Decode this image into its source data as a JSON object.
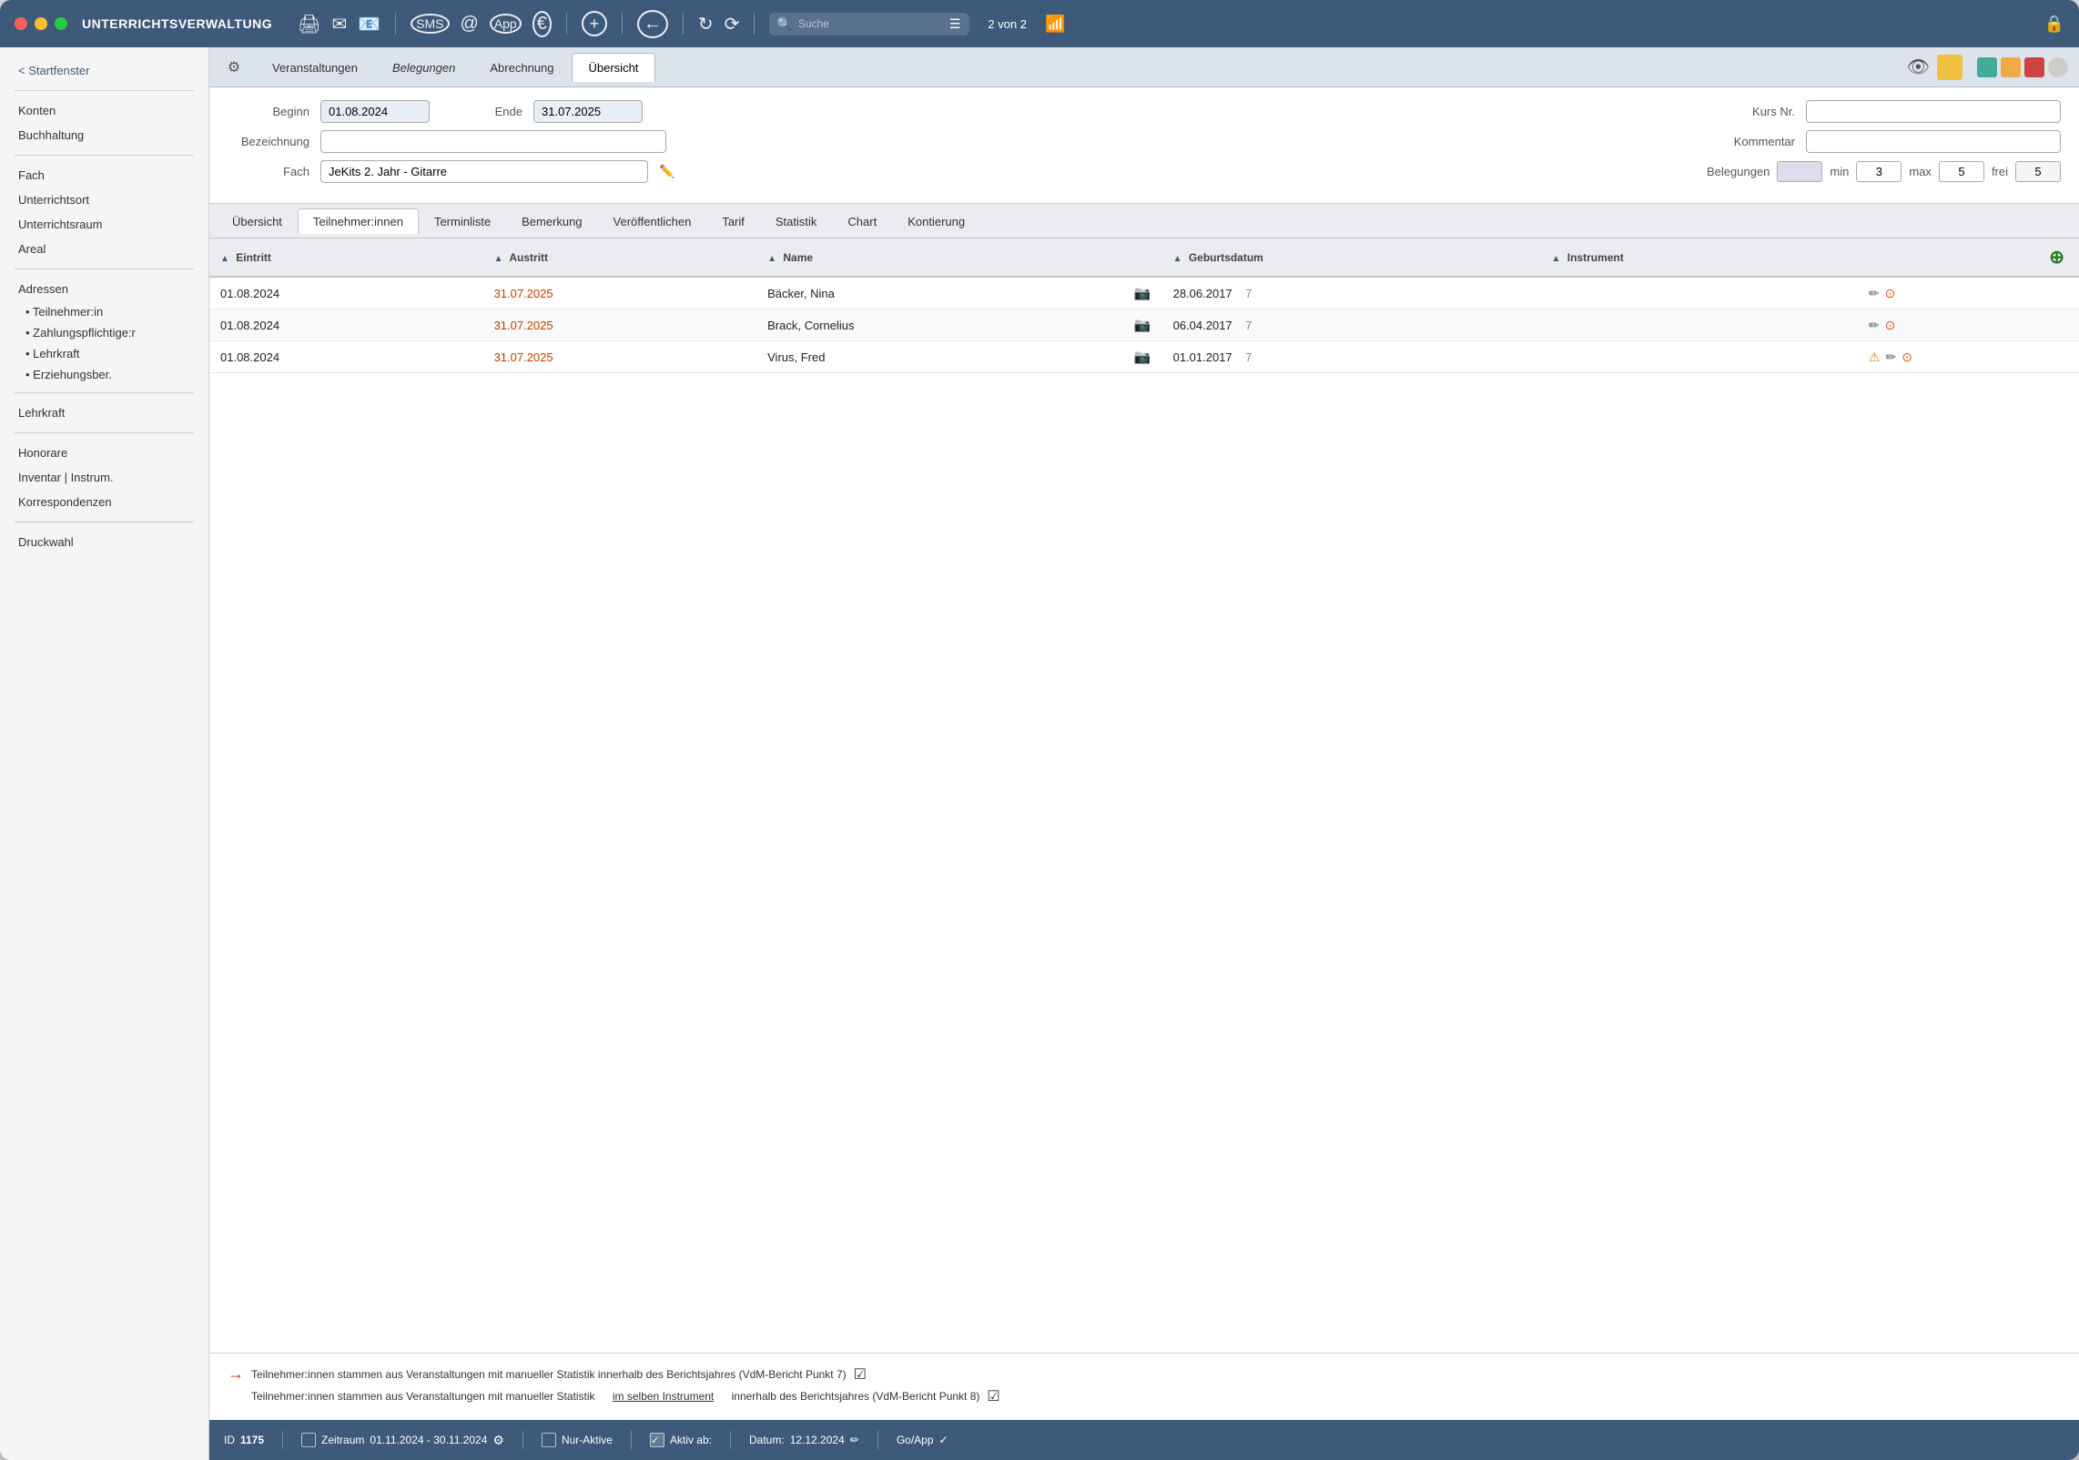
{
  "window": {
    "title": "UNTERRICHTSVERWALTUNG"
  },
  "titlebar": {
    "app_name": "UNTERRICHTSVERWALTUNG",
    "record_nav": "2 von 2",
    "search_placeholder": "Suche"
  },
  "main_tabs": {
    "items": [
      {
        "id": "veranstaltungen",
        "label": "Veranstaltungen",
        "active": false
      },
      {
        "id": "belegungen",
        "label": "Belegungen",
        "active": false
      },
      {
        "id": "abrechnung",
        "label": "Abrechnung",
        "active": false
      },
      {
        "id": "uebersicht",
        "label": "Übersicht",
        "active": true
      }
    ]
  },
  "form": {
    "beginn_label": "Beginn",
    "beginn_value": "01.08.2024",
    "ende_label": "Ende",
    "ende_value": "31.07.2025",
    "kurs_nr_label": "Kurs Nr.",
    "kurs_nr_value": "",
    "bezeichnung_label": "Bezeichnung",
    "bezeichnung_value": "",
    "kommentar_label": "Kommentar",
    "kommentar_value": "",
    "fach_label": "Fach",
    "fach_value": "JeKits 2. Jahr - Gitarre",
    "belegungen_label": "Belegungen",
    "belegungen_value": "",
    "min_label": "min",
    "min_value": "3",
    "max_label": "max",
    "max_value": "5",
    "frei_label": "frei",
    "frei_value": "5"
  },
  "sub_tabs": {
    "items": [
      {
        "id": "uebersicht",
        "label": "Übersicht",
        "active": false
      },
      {
        "id": "teilnehmer",
        "label": "Teilnehmer:innen",
        "active": true
      },
      {
        "id": "terminliste",
        "label": "Terminliste",
        "active": false
      },
      {
        "id": "bemerkung",
        "label": "Bemerkung",
        "active": false
      },
      {
        "id": "veroeffentlichen",
        "label": "Veröffentlichen",
        "active": false
      },
      {
        "id": "tarif",
        "label": "Tarif",
        "active": false
      },
      {
        "id": "statistik",
        "label": "Statistik",
        "active": false
      },
      {
        "id": "chart",
        "label": "Chart",
        "active": false
      },
      {
        "id": "kontierung",
        "label": "Kontierung",
        "active": false
      }
    ]
  },
  "table": {
    "columns": [
      {
        "id": "eintritt",
        "label": "Eintritt"
      },
      {
        "id": "austritt",
        "label": "Austritt"
      },
      {
        "id": "name",
        "label": "Name"
      },
      {
        "id": "foto",
        "label": ""
      },
      {
        "id": "geburtsdatum",
        "label": "Geburtsdatum"
      },
      {
        "id": "instrument",
        "label": "Instrument"
      }
    ],
    "rows": [
      {
        "eintritt": "01.08.2024",
        "austritt": "31.07.2025",
        "name": "Bäcker, Nina",
        "geburtsdatum": "28.06.2017",
        "age": "7",
        "instrument": "",
        "has_warning": false
      },
      {
        "eintritt": "01.08.2024",
        "austritt": "31.07.2025",
        "name": "Brack, Cornelius",
        "geburtsdatum": "06.04.2017",
        "age": "7",
        "instrument": "",
        "has_warning": false
      },
      {
        "eintritt": "01.08.2024",
        "austritt": "31.07.2025",
        "name": "Virus, Fred",
        "geburtsdatum": "01.01.2017",
        "age": "7",
        "instrument": "",
        "has_warning": true
      }
    ]
  },
  "footer": {
    "note1": "Teilnehmer:innen stammen aus Veranstaltungen mit manueller Statistik innerhalb des Berichtsjahres (VdM-Bericht Punkt 7)",
    "note2_pre": "Teilnehmer:innen stammen aus Veranstaltungen mit manueller Statistik",
    "note2_underline": "im selben Instrument",
    "note2_post": "innerhalb des Berichtsjahres (VdM-Bericht Punkt 8)"
  },
  "status_bar": {
    "id_label": "ID",
    "id_value": "1175",
    "zeitraum_label": "Zeitraum",
    "zeitraum_value": "01.11.2024 - 30.11.2024",
    "nur_aktive_label": "Nur-Aktive",
    "aktiv_ab_label": "Aktiv ab:",
    "datum_label": "Datum:",
    "datum_value": "12.12.2024",
    "go_app_label": "Go/App"
  },
  "sidebar": {
    "back_label": "< Startfenster",
    "items": [
      {
        "label": "Konten"
      },
      {
        "label": "Buchhaltung"
      }
    ],
    "section2": [
      {
        "label": "Fach"
      },
      {
        "label": "Unterrichtsort"
      },
      {
        "label": "Unterrichtsraum"
      },
      {
        "label": "Areal"
      }
    ],
    "section3_title": "Adressen",
    "section3": [
      {
        "label": "• Teilnehmer:in"
      },
      {
        "label": "• Zahlungspflichtige:r"
      },
      {
        "label": "• Lehrkraft"
      },
      {
        "label": "• Erziehungsber."
      }
    ],
    "section4": [
      {
        "label": "Lehrkraft"
      }
    ],
    "section5": [
      {
        "label": "Honorare"
      },
      {
        "label": "Inventar | Instrum."
      },
      {
        "label": "Korrespondenzen"
      }
    ],
    "section6": [
      {
        "label": "Druckwahl"
      }
    ]
  }
}
